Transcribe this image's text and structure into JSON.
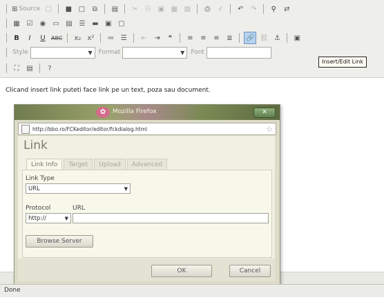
{
  "toolbar": {
    "source_label": "Source",
    "style_label": "Style",
    "format_label": "Format",
    "font_label": "Font",
    "bold_label": "B",
    "italic_label": "I",
    "underline_label": "U",
    "strike_label": "ABC",
    "tooltip": "Insert/Edit Link"
  },
  "instruction": "Clicand insert link puteti face link pe un text, poza sau document.",
  "window": {
    "title": "Mozilla Firefox",
    "close_label": "✕",
    "address": "http://bbo.ro/FCKeditor/editor/fckdialog.html"
  },
  "dialog": {
    "title": "Link",
    "tabs": [
      "Link Info",
      "Target",
      "Upload",
      "Advanced"
    ],
    "link_type_label": "Link Type",
    "link_type_value": "URL",
    "protocol_label": "Protocol",
    "protocol_value": "http://",
    "url_label": "URL",
    "url_value": "",
    "browse_button": "Browse Server",
    "ok_button": "OK",
    "cancel_button": "Cancel"
  },
  "statusbar": {
    "text": "Done"
  },
  "colors": {
    "toolbar_bg": "#eeeeea",
    "dialog_bg": "#f1f1e3",
    "highlight": "#b9d2ee"
  }
}
